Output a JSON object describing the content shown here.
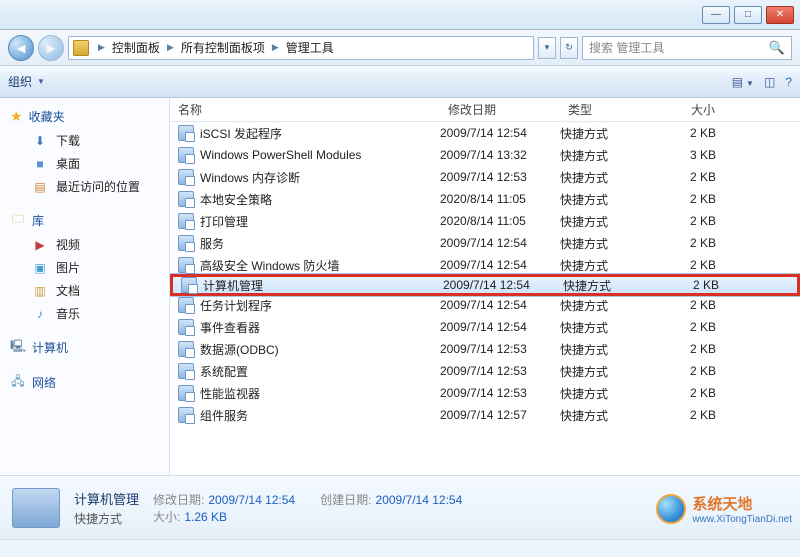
{
  "window_controls": {
    "min": "—",
    "max": "□",
    "close": "✕"
  },
  "breadcrumb": {
    "items": [
      "控制面板",
      "所有控制面板项",
      "管理工具"
    ]
  },
  "search_placeholder": "搜索 管理工具",
  "toolbar": {
    "organize": "组织"
  },
  "sidebar": {
    "favorites": {
      "label": "收藏夹",
      "items": [
        "下载",
        "桌面",
        "最近访问的位置"
      ]
    },
    "libraries": {
      "label": "库",
      "items": [
        "视频",
        "图片",
        "文档",
        "音乐"
      ]
    },
    "computer": {
      "label": "计算机"
    },
    "network": {
      "label": "网络"
    }
  },
  "columns": {
    "name": "名称",
    "date": "修改日期",
    "type": "类型",
    "size": "大小"
  },
  "type_label": "快捷方式",
  "files": [
    {
      "name": "iSCSI 发起程序",
      "date": "2009/7/14 12:54",
      "size": "2 KB"
    },
    {
      "name": "Windows PowerShell Modules",
      "date": "2009/7/14 13:32",
      "size": "3 KB"
    },
    {
      "name": "Windows 内存诊断",
      "date": "2009/7/14 12:53",
      "size": "2 KB"
    },
    {
      "name": "本地安全策略",
      "date": "2020/8/14 11:05",
      "size": "2 KB"
    },
    {
      "name": "打印管理",
      "date": "2020/8/14 11:05",
      "size": "2 KB"
    },
    {
      "name": "服务",
      "date": "2009/7/14 12:54",
      "size": "2 KB"
    },
    {
      "name": "高级安全 Windows 防火墙",
      "date": "2009/7/14 12:54",
      "size": "2 KB"
    },
    {
      "name": "计算机管理",
      "date": "2009/7/14 12:54",
      "size": "2 KB",
      "selected": true,
      "highlight": true
    },
    {
      "name": "任务计划程序",
      "date": "2009/7/14 12:54",
      "size": "2 KB"
    },
    {
      "name": "事件查看器",
      "date": "2009/7/14 12:54",
      "size": "2 KB"
    },
    {
      "name": "数据源(ODBC)",
      "date": "2009/7/14 12:53",
      "size": "2 KB"
    },
    {
      "name": "系统配置",
      "date": "2009/7/14 12:53",
      "size": "2 KB"
    },
    {
      "name": "性能监视器",
      "date": "2009/7/14 12:53",
      "size": "2 KB"
    },
    {
      "name": "组件服务",
      "date": "2009/7/14 12:57",
      "size": "2 KB"
    }
  ],
  "details": {
    "title": "计算机管理",
    "mod_label": "修改日期:",
    "mod_value": "2009/7/14 12:54",
    "create_label": "创建日期:",
    "create_value": "2009/7/14 12:54",
    "type_label": "快捷方式",
    "size_label": "大小:",
    "size_value": "1.26 KB"
  },
  "watermark": {
    "cn": "系统天地",
    "url": "www.XiTongTianDi.net"
  }
}
